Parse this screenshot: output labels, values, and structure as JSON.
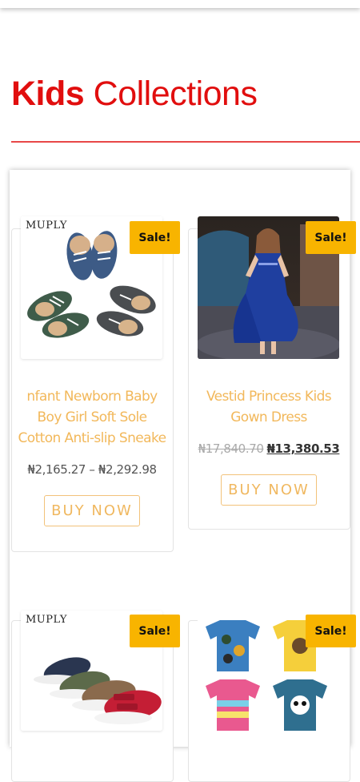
{
  "section": {
    "title_bold": "Kids",
    "title_rest": " Collections"
  },
  "products": [
    {
      "brand": "MUPLY",
      "sale": "Sale!",
      "name": "nfant Newborn Baby Boy Girl Soft Sole Cotton Anti-slip Sneake",
      "price_range": "₦2,165.27 – ₦2,292.98",
      "button": "BUY NOW"
    },
    {
      "sale": "Sale!",
      "name": "Vestid Princess Kids Gown Dress",
      "price_old": "₦17,840.70",
      "price_new": "₦13,380.53",
      "button": "BUY NOW"
    },
    {
      "brand": "MUPLY",
      "sale": "Sale!"
    },
    {
      "sale": "Sale!"
    }
  ],
  "colors": {
    "accent": "#e10e0e",
    "sale_badge": "#f8b400",
    "product_text": "#f2b85b"
  }
}
